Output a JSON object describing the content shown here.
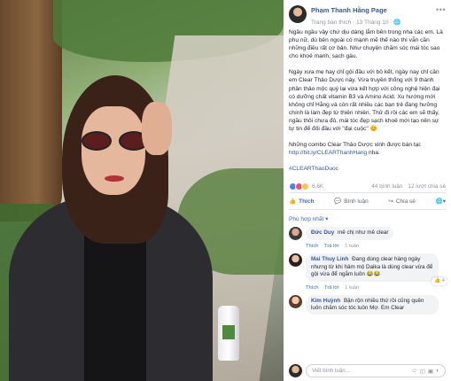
{
  "post": {
    "page_name": "Phạm Thanh Hằng Page",
    "meta": "Trang bạn thích · 13 Tháng 10 · 🌐",
    "more_icon": "ellipsis-icon",
    "paragraphs": [
      "Ngầu ngầu vậy chứ dịu dàng lắm bên trong nha các em. Là phụ nữ, dù bên ngoài có mạnh mẽ thế nào thì vẫn cần những điều rất cơ bản. Như chuyện chăm sóc mái tóc sao cho khoẻ mạnh, sạch gàu.",
      "Ngày xưa mẹ hay chỉ gội đầu với bồ kết, ngày nay chỉ cần em Clear Thảo Dược này. Vừa truyền thống với 9 thành phần thảo mộc quý lại vừa kết hợp với công nghệ hiện đại có dưỡng chất vitamin B3 và Amino Acid. Xu hướng mới không chỉ Hằng và còn rất nhiều các bạn trẻ đang hưởng chính là làm đẹp từ thiên nhiên. Thử đi rồi các em sẽ thấy, ngầu thôi chưa đủ, mái tóc đẹp sạch khoẻ mới tạo nên sự tự tin để đối đầu với \"đại cuộc\" 😊",
      "Những combo Clear Thảo Dược xinh được bán tại:"
    ],
    "link": "http://bit.ly/CLEARThanhHang",
    "link_suffix": " nha.",
    "hashtag": "#CLEARThaoDuoc",
    "reactions_count": "6,6K",
    "comments_count": "44 bình luận",
    "shares_count": "12 lượt chia sẻ",
    "actions": {
      "like": "Thích",
      "comment": "Bình luận",
      "share": "Chia sẻ"
    },
    "sort_label": "Phù hợp nhất ▾",
    "colors": {
      "link": "#365899",
      "accent": "#4267b2"
    }
  },
  "comments": [
    {
      "name": "Đức Duy",
      "text": "mê chị như mê clear",
      "actions": [
        "Thích",
        "Trả lời"
      ],
      "time": "1 tuần",
      "reaction": ""
    },
    {
      "name": "Mai Thuy Linh",
      "text": "Đang dùng clear hàng ngày nhưng từ khi hâm mộ Daika là dùng clear vừa để gội vừa để ngắm luôn 😂😂",
      "actions": [
        "Thích",
        "Trả lời"
      ],
      "time": "1 tuần",
      "reaction": "👍 4"
    },
    {
      "name": "Kim Huỳnh",
      "text": "Bận rộn nhiều thứ rồi cũng quên luôn chăm sóc tóc luôn Mợ. Em Clear",
      "actions": [],
      "time": "",
      "reaction": ""
    }
  ],
  "composer": {
    "placeholder": "Viết bình luận..."
  }
}
